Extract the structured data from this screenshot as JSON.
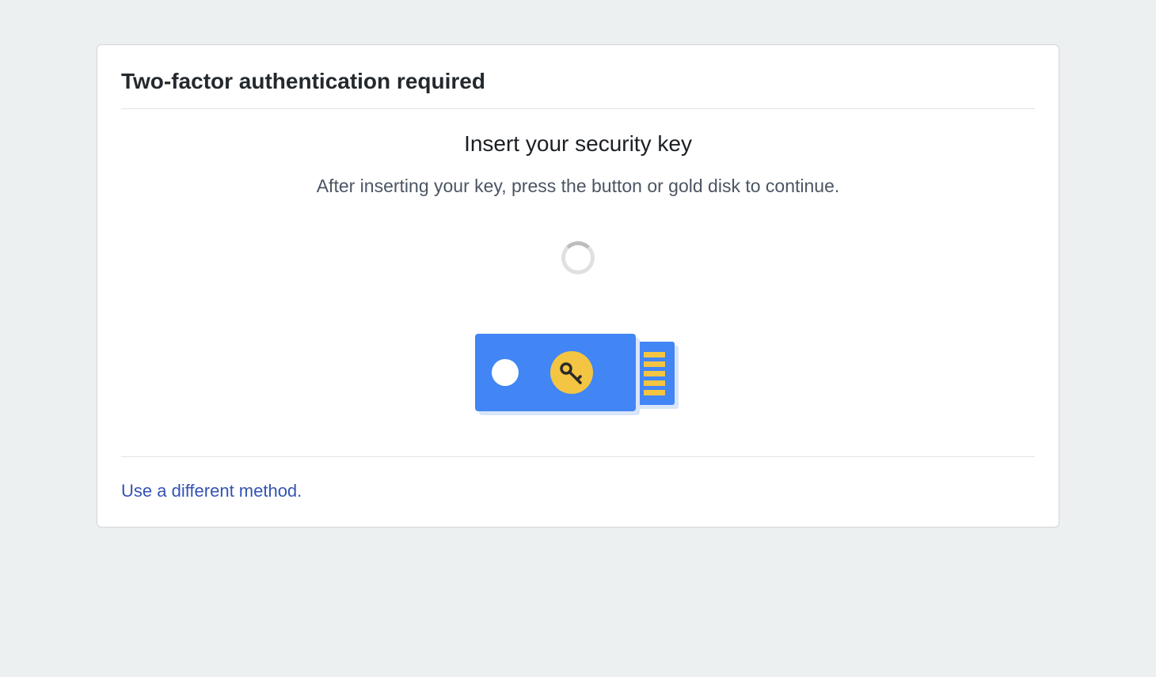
{
  "card": {
    "title": "Two-factor authentication required"
  },
  "content": {
    "heading": "Insert your security key",
    "subtext": "After inserting your key, press the button or gold disk to continue."
  },
  "footer": {
    "alt_method_link": "Use a different method."
  },
  "colors": {
    "primary_blue": "#4285f4",
    "accent_gold": "#f4c542",
    "link_blue": "#3454b4"
  }
}
